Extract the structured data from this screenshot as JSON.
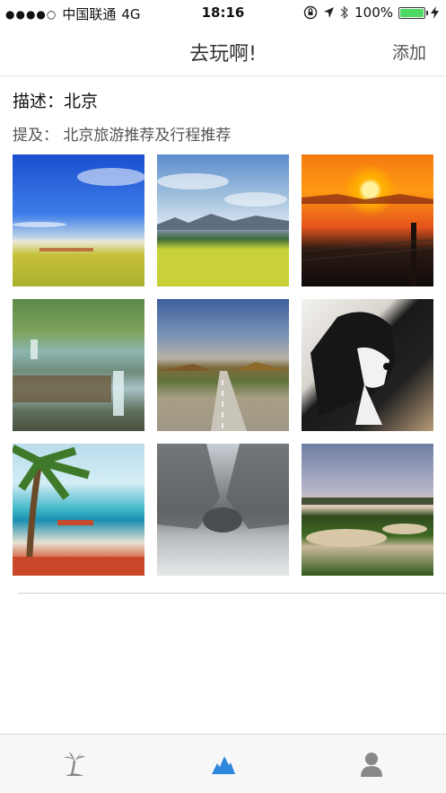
{
  "status_bar": {
    "signal_dots": "●●●●○",
    "carrier": "中国联通",
    "network": "4G",
    "time": "18:16",
    "battery_percent": "100%",
    "battery_level": 1.0,
    "icons": [
      "orientation-lock-icon",
      "location-arrow-icon",
      "bluetooth-icon",
      "charging-bolt-icon"
    ],
    "battery_color": "#4cd964"
  },
  "nav": {
    "title": "去玩啊!",
    "add_label": "添加"
  },
  "content": {
    "description": "描述：北京",
    "mention": "提及：  北京旅游推荐及行程推荐",
    "photos": [
      {
        "subject": "blue sky over rapeseed field"
      },
      {
        "subject": "mountains behind yellow field"
      },
      {
        "subject": "orange sunset over fence"
      },
      {
        "subject": "waterfall in forest"
      },
      {
        "subject": "road under cloudy sky"
      },
      {
        "subject": "black and white border collie"
      },
      {
        "subject": "palm tree on beach with boat"
      },
      {
        "subject": "misty grey rock formation"
      },
      {
        "subject": "golf course landscape"
      }
    ]
  },
  "tab_bar": {
    "tabs": [
      {
        "icon": "palm-tree-icon",
        "active": false
      },
      {
        "icon": "mountains-icon",
        "active": true
      },
      {
        "icon": "person-icon",
        "active": false
      }
    ],
    "active_color": "#2e86de",
    "inactive_color": "#888888"
  }
}
